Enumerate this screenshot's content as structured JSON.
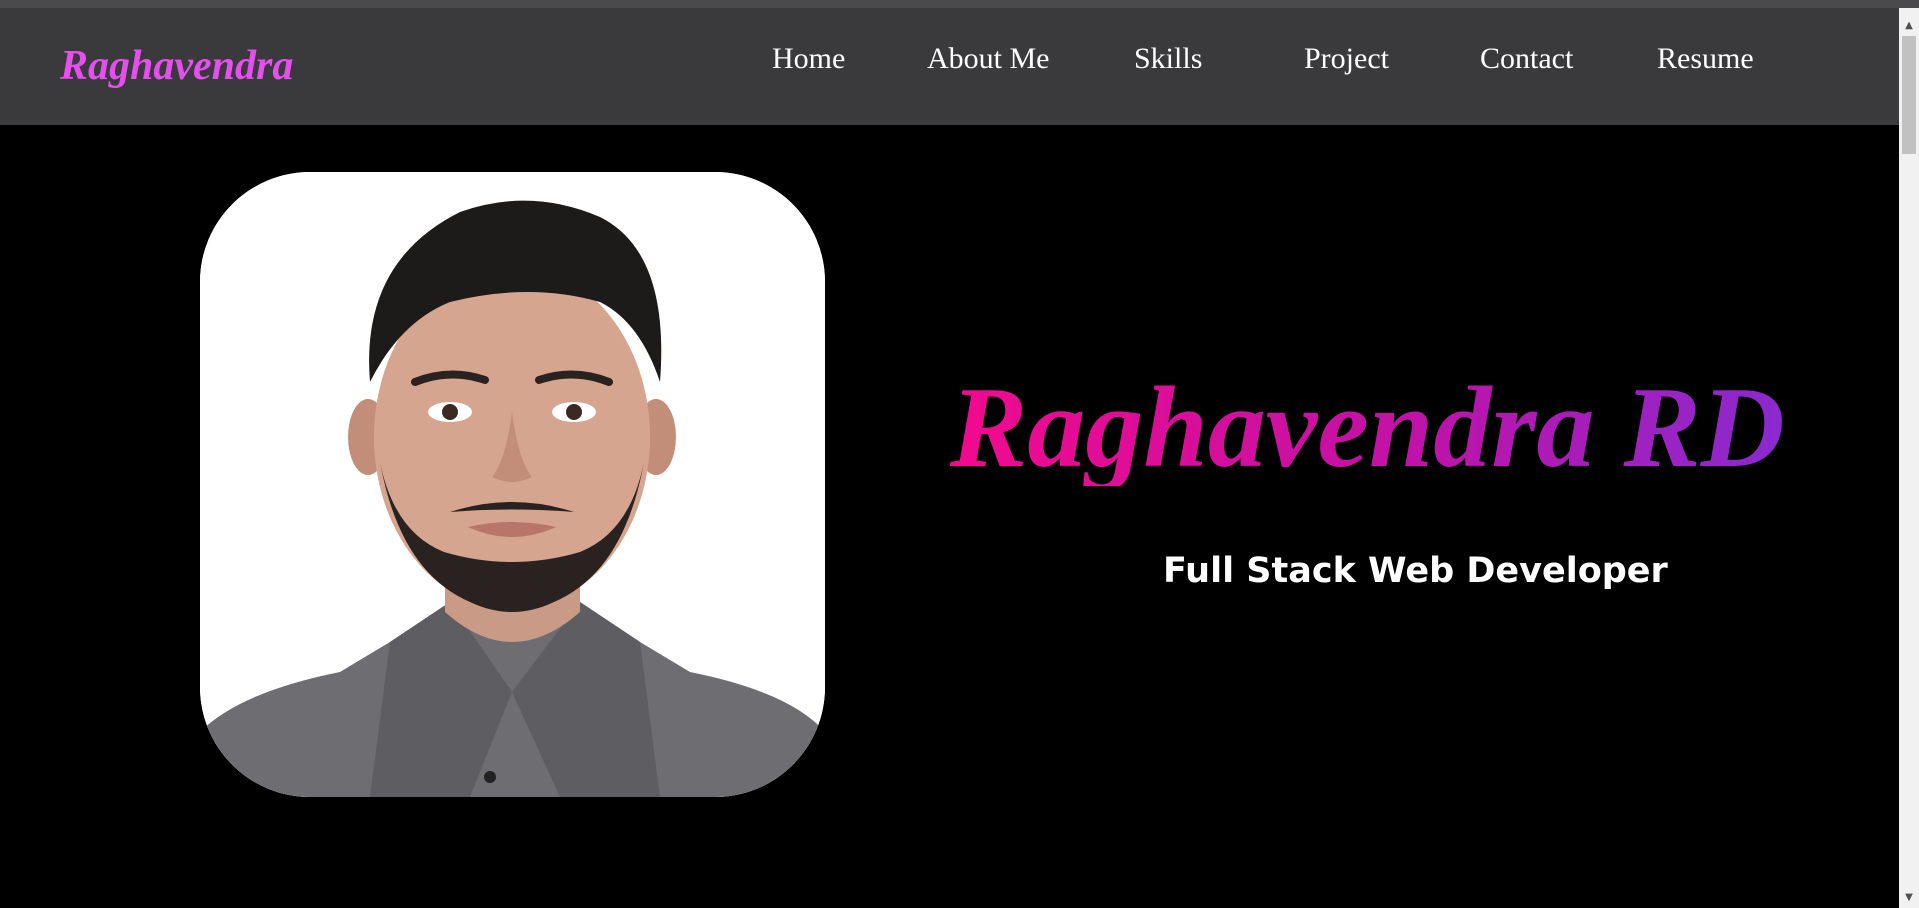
{
  "header": {
    "brand": "Raghavendra",
    "nav": [
      {
        "label": "Home"
      },
      {
        "label": "About Me"
      },
      {
        "label": "Skills"
      },
      {
        "label": "Project"
      },
      {
        "label": "Contact"
      },
      {
        "label": "Resume"
      }
    ]
  },
  "hero": {
    "name": "Raghavendra RD",
    "subtitle": "Full Stack Web Developer"
  },
  "colors": {
    "nav_bg": "#3a393b",
    "brand": "#e64ef0",
    "gradient_start": "#f20a8e",
    "gradient_end": "#8a2ad0",
    "page_bg": "#000000"
  },
  "icons": {
    "scroll_up": "scroll-up-arrow-icon",
    "scroll_down": "scroll-down-arrow-icon"
  }
}
